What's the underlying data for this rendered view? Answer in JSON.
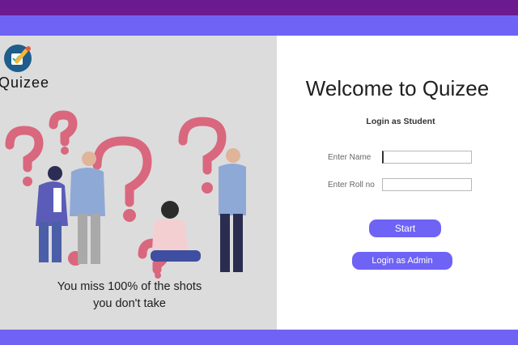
{
  "brand": {
    "name": "Quizee"
  },
  "illustration": {
    "quote_line1": "You miss 100% of the shots",
    "quote_line2": "you don't take"
  },
  "login": {
    "welcome": "Welcome to Quizee",
    "subtitle": "Login as Student",
    "name_label": "Enter Name",
    "name_value": "",
    "roll_label": "Enter Roll no",
    "roll_value": "",
    "start_button": "Start",
    "admin_button": "Login as Admin"
  },
  "colors": {
    "top_dark": "#6c1a8f",
    "accent": "#6f63f5",
    "panel_gray": "#dcdcdc",
    "question_mark": "#d9677e"
  }
}
